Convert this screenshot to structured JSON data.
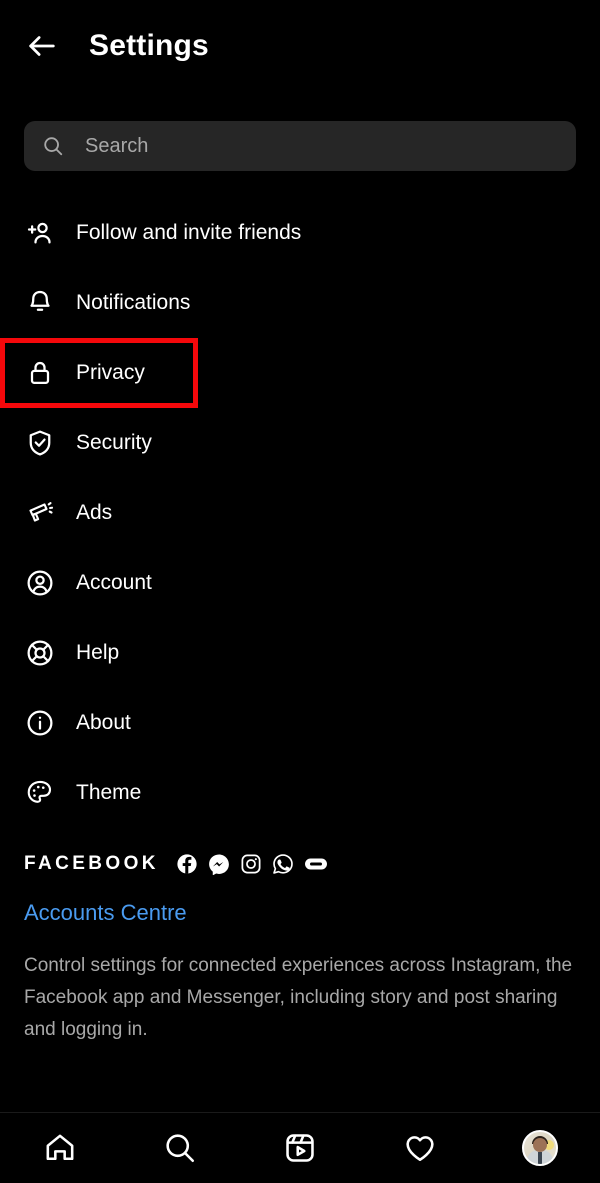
{
  "header": {
    "back_icon": "back-arrow-icon",
    "title": "Settings"
  },
  "search": {
    "icon": "search-icon",
    "placeholder": "Search",
    "value": ""
  },
  "menu": {
    "items": [
      {
        "label": "Follow and invite friends",
        "icon": "person-add-icon",
        "highlighted": false
      },
      {
        "label": "Notifications",
        "icon": "bell-icon",
        "highlighted": false
      },
      {
        "label": "Privacy",
        "icon": "lock-icon",
        "highlighted": true
      },
      {
        "label": "Security",
        "icon": "shield-check-icon",
        "highlighted": false
      },
      {
        "label": "Ads",
        "icon": "megaphone-icon",
        "highlighted": false
      },
      {
        "label": "Account",
        "icon": "person-circle-icon",
        "highlighted": false
      },
      {
        "label": "Help",
        "icon": "lifebuoy-icon",
        "highlighted": false
      },
      {
        "label": "About",
        "icon": "info-circle-icon",
        "highlighted": false
      },
      {
        "label": "Theme",
        "icon": "palette-icon",
        "highlighted": false
      }
    ]
  },
  "facebook_section": {
    "heading": "FACEBOOK",
    "app_icons": [
      "facebook-icon",
      "messenger-icon",
      "instagram-icon",
      "whatsapp-icon",
      "portal-icon"
    ],
    "link_label": "Accounts Centre",
    "description": "Control settings for connected experiences across Instagram, the Facebook app and Messenger, including story and post sharing and logging in."
  },
  "bottom_nav": {
    "items": [
      {
        "icon": "home-icon"
      },
      {
        "icon": "search-icon"
      },
      {
        "icon": "reels-icon"
      },
      {
        "icon": "heart-icon"
      },
      {
        "icon": "profile-avatar"
      }
    ]
  },
  "colors": {
    "background": "#000000",
    "text_primary": "#ffffff",
    "text_secondary": "#a8a8a8",
    "search_field": "#262626",
    "link_blue": "#4a9bf0",
    "highlight_red": "#f5080b"
  }
}
